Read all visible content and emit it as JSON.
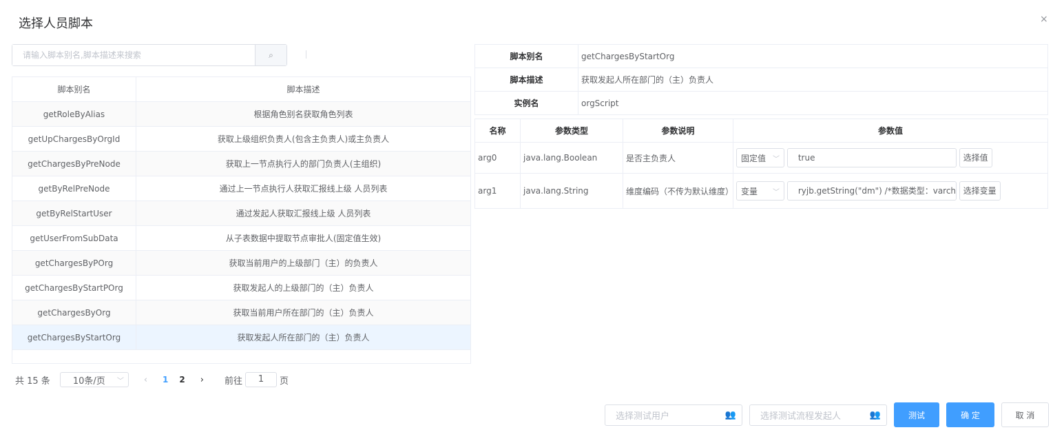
{
  "dialog": {
    "title": "选择人员脚本",
    "close": "×"
  },
  "search": {
    "placeholder": "请输入脚本别名,脚本描述来搜索",
    "icon": "⌕"
  },
  "list": {
    "headers": [
      "脚本别名",
      "脚本描述"
    ],
    "rows": [
      [
        "getRoleByAlias",
        "根据角色别名获取角色列表"
      ],
      [
        "getUpChargesByOrgId",
        "获取上级组织负责人(包含主负责人)或主负责人"
      ],
      [
        "getChargesByPreNode",
        "获取上一节点执行人的部门负责人(主组织)"
      ],
      [
        "getByRelPreNode",
        "通过上一节点执行人获取汇报线上级 人员列表"
      ],
      [
        "getByRelStartUser",
        "通过发起人获取汇报线上级 人员列表"
      ],
      [
        "getUserFromSubData",
        "从子表数据中提取节点审批人(固定值生效)"
      ],
      [
        "getChargesByPOrg",
        "获取当前用户的上级部门（主）的负责人"
      ],
      [
        "getChargesByStartPOrg",
        "获取发起人的上级部门的（主）负责人"
      ],
      [
        "getChargesByOrg",
        "获取当前用户所在部门的（主）负责人"
      ],
      [
        "getChargesByStartOrg",
        "获取发起人所在部门的（主）负责人"
      ]
    ],
    "selected_index": 9
  },
  "pagination": {
    "total": "共 15 条",
    "page_size": "10条/页",
    "pages": [
      "1",
      "2"
    ],
    "current": "1",
    "goto_label": "前往",
    "goto_value": "1",
    "page_suffix": "页"
  },
  "info": [
    [
      "脚本别名",
      "getChargesByStartOrg"
    ],
    [
      "脚本描述",
      "获取发起人所在部门的（主）负责人"
    ],
    [
      "实例名",
      "orgScript"
    ]
  ],
  "params": {
    "headers": [
      "名称",
      "参数类型",
      "参数说明",
      "参数值"
    ],
    "rows": [
      {
        "name": "arg0",
        "type": "java.lang.Boolean",
        "desc": "是否主负责人",
        "mode": "固定值",
        "value": "true",
        "button": "选择值"
      },
      {
        "name": "arg1",
        "type": "java.lang.String",
        "desc": "维度编码（不传为默认维度）",
        "mode": "变量",
        "value": "ryjb.getString(\"dm\") /*数据类型：varchar",
        "button": "选择变量"
      }
    ]
  },
  "footer": {
    "test_user_placeholder": "选择测试用户",
    "test_starter_placeholder": "选择测试流程发起人",
    "test": "测试",
    "ok": "确 定",
    "cancel": "取 消"
  },
  "colors": {
    "primary": "#409eff",
    "selected_row": "#ecf5ff"
  }
}
